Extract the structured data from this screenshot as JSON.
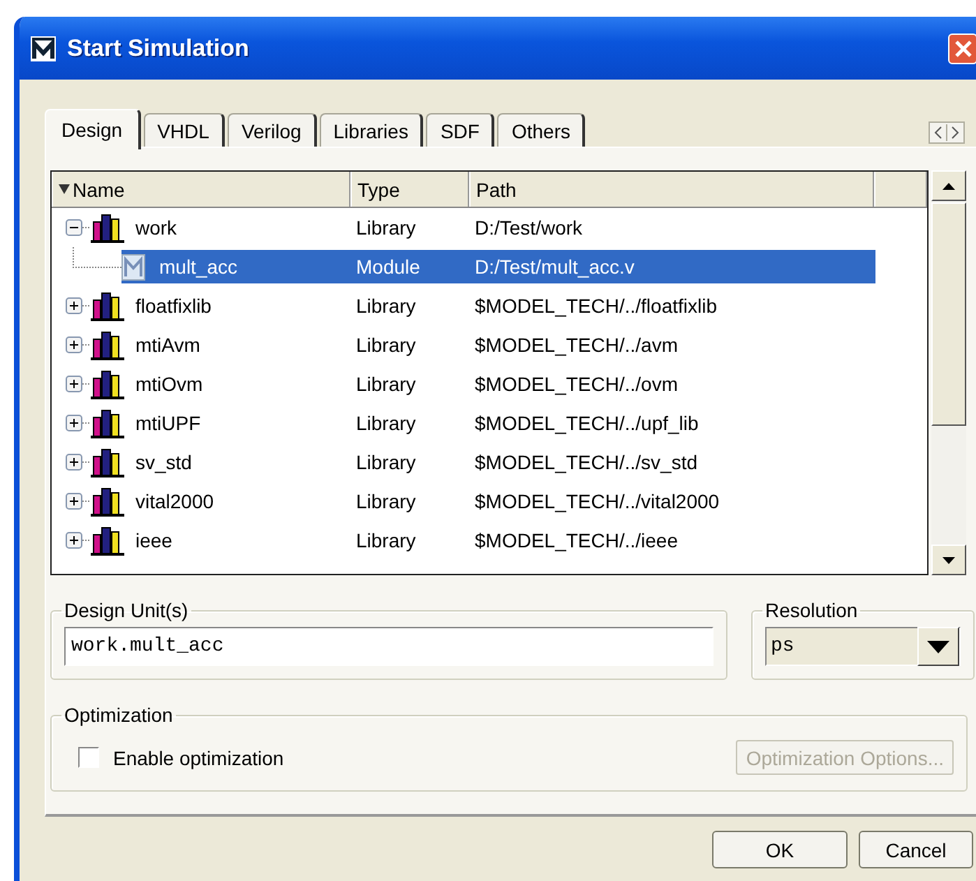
{
  "window": {
    "title": "Start Simulation"
  },
  "tabs": [
    {
      "label": "Design",
      "selected": true
    },
    {
      "label": "VHDL",
      "selected": false
    },
    {
      "label": "Verilog",
      "selected": false
    },
    {
      "label": "Libraries",
      "selected": false
    },
    {
      "label": "SDF",
      "selected": false
    },
    {
      "label": "Others",
      "selected": false
    }
  ],
  "tree": {
    "columns": [
      "Name",
      "Type",
      "Path"
    ],
    "rows": [
      {
        "kind": "library",
        "name": "work",
        "type": "Library",
        "path": "D:/Test/work",
        "expanded": true,
        "selected": false,
        "children": [
          {
            "kind": "module",
            "name": "mult_acc",
            "type": "Module",
            "path": "D:/Test/mult_acc.v",
            "selected": true
          }
        ]
      },
      {
        "kind": "library",
        "name": "floatfixlib",
        "type": "Library",
        "path": "$MODEL_TECH/../floatfixlib",
        "expanded": false,
        "selected": false
      },
      {
        "kind": "library",
        "name": "mtiAvm",
        "type": "Library",
        "path": "$MODEL_TECH/../avm",
        "expanded": false,
        "selected": false
      },
      {
        "kind": "library",
        "name": "mtiOvm",
        "type": "Library",
        "path": "$MODEL_TECH/../ovm",
        "expanded": false,
        "selected": false
      },
      {
        "kind": "library",
        "name": "mtiUPF",
        "type": "Library",
        "path": "$MODEL_TECH/../upf_lib",
        "expanded": false,
        "selected": false
      },
      {
        "kind": "library",
        "name": "sv_std",
        "type": "Library",
        "path": "$MODEL_TECH/../sv_std",
        "expanded": false,
        "selected": false
      },
      {
        "kind": "library",
        "name": "vital2000",
        "type": "Library",
        "path": "$MODEL_TECH/../vital2000",
        "expanded": false,
        "selected": false
      },
      {
        "kind": "library",
        "name": "ieee",
        "type": "Library",
        "path": "$MODEL_TECH/../ieee",
        "expanded": false,
        "selected": false
      }
    ]
  },
  "design_units": {
    "label": "Design Unit(s)",
    "value": "work.mult_acc"
  },
  "resolution": {
    "label": "Resolution",
    "value": "ps"
  },
  "optimization": {
    "label": "Optimization",
    "checkbox": {
      "label": "Enable optimization",
      "checked": false
    },
    "options_button": {
      "label": "Optimization Options...",
      "disabled": true
    }
  },
  "buttons": [
    "OK",
    "Cancel"
  ]
}
